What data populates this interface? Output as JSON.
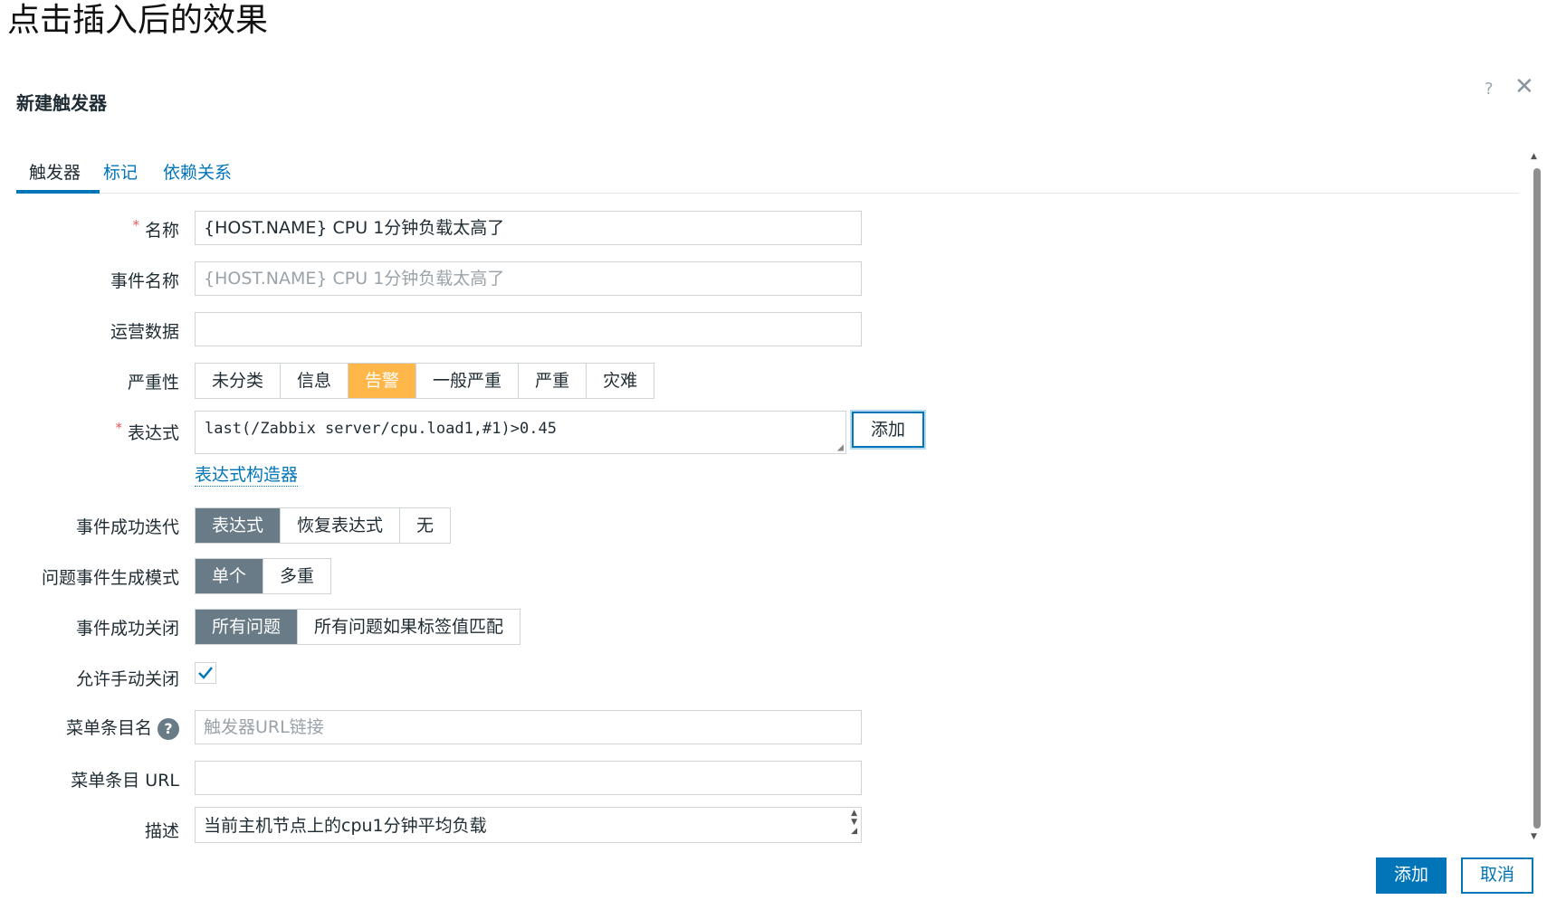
{
  "page_heading": "点击插入后的效果",
  "dialog": {
    "title": "新建触发器",
    "help_label": "?",
    "close_label": "✕"
  },
  "tabs": [
    {
      "label": "触发器",
      "active": true
    },
    {
      "label": "标记",
      "active": false
    },
    {
      "label": "依赖关系",
      "active": false
    }
  ],
  "form": {
    "name": {
      "label": "名称",
      "required_mark": "*",
      "value": "{HOST.NAME} CPU 1分钟负载太高了"
    },
    "event_name": {
      "label": "事件名称",
      "placeholder": "{HOST.NAME} CPU 1分钟负载太高了"
    },
    "opdata": {
      "label": "运营数据",
      "value": ""
    },
    "severity": {
      "label": "严重性",
      "options": [
        "未分类",
        "信息",
        "告警",
        "一般严重",
        "严重",
        "灾难"
      ],
      "selected": "告警"
    },
    "expression": {
      "label": "表达式",
      "required_mark": "*",
      "value": "last(/Zabbix server/cpu.load1,#1)>0.45",
      "add_label": "添加",
      "builder_link": "表达式构造器"
    },
    "ok_event_generation": {
      "label": "事件成功迭代",
      "options": [
        "表达式",
        "恢复表达式",
        "无"
      ],
      "selected": "表达式"
    },
    "problem_mode": {
      "label": "问题事件生成模式",
      "options": [
        "单个",
        "多重"
      ],
      "selected": "单个"
    },
    "ok_event_closes": {
      "label": "事件成功关闭",
      "options": [
        "所有问题",
        "所有问题如果标签值匹配"
      ],
      "selected": "所有问题"
    },
    "manual_close": {
      "label": "允许手动关闭",
      "checked": true
    },
    "url_name": {
      "label": "菜单条目名",
      "help": "?",
      "placeholder": "触发器URL链接"
    },
    "url": {
      "label": "菜单条目 URL",
      "value": ""
    },
    "description": {
      "label": "描述",
      "value": "当前主机节点上的cpu1分钟平均负载"
    }
  },
  "footer": {
    "add_label": "添加",
    "cancel_label": "取消"
  },
  "colors": {
    "accent": "#0275b8",
    "selected_segment": "#687b87",
    "warning": "#ffb74a",
    "required": "#e45959"
  }
}
